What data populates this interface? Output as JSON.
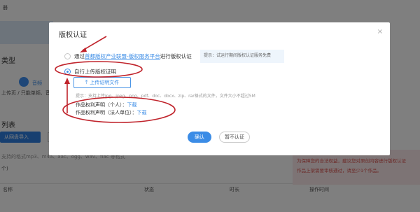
{
  "background": {
    "top_left": "器",
    "type_heading": "类型",
    "step_label": "音频",
    "tag_hint": "上传页 / 只能单频、音频",
    "list_heading": "列表",
    "import_button": "从网盘导入",
    "formats": "支持的格式mp3、m4a、aac、ogg、wav、flac 等格式",
    "chars": "个)",
    "columns": [
      "名称",
      "状态",
      "时长",
      "操作时间"
    ],
    "pink_line1": "为保障您的合法权益，建议您对原创内容进行版权认证",
    "pink_line2": "作品上架需要审核通过，请至少1个作品。"
  },
  "dialog": {
    "title": "版权认证",
    "close_symbol": "×",
    "option1": {
      "prefix": "通过",
      "link": "首都版权产业联盟-版权服务平台",
      "suffix": "进行版权认证"
    },
    "hint": "提示：试运行期间版权认证服务免费",
    "option2": "自行上传版权证明",
    "upload_button": "上传证明文件",
    "upload_icon": "⤒",
    "tip": "提示：支持上传jpg、jpeg、png、pdf、doc、docx、zip、rar格式的文件，文件大小不超过5M",
    "declaration_personal": {
      "label": "作品权利声明（个人）：",
      "link": "下载"
    },
    "declaration_entity": {
      "label": "作品权利声明（法人单位）：",
      "link": "下载"
    },
    "confirm_button": "确认",
    "cancel_button": "暂不认证"
  },
  "colors": {
    "accent": "#3b8ce6",
    "annotation": "#c0232b",
    "overlay": "rgba(0,0,0,0.5)"
  }
}
